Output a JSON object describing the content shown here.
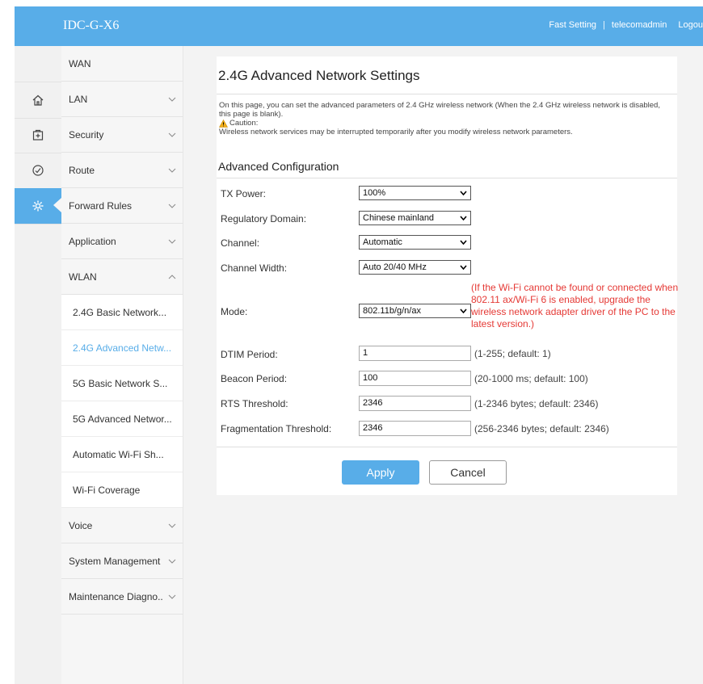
{
  "header": {
    "brand": "IDC-G-X6",
    "fast_setting": "Fast Setting",
    "separator": "|",
    "user": "telecomadmin",
    "logout": "Logou"
  },
  "iconbar": {
    "items": [
      {
        "icon": "home-icon"
      },
      {
        "icon": "plus-box-icon"
      },
      {
        "icon": "check-circle-icon"
      },
      {
        "icon": "gear-icon"
      }
    ]
  },
  "menu": {
    "items": [
      {
        "label": "WAN"
      },
      {
        "label": "LAN"
      },
      {
        "label": "Security"
      },
      {
        "label": "Route"
      },
      {
        "label": "Forward Rules"
      },
      {
        "label": "Application"
      },
      {
        "label": "WLAN"
      }
    ],
    "wlan_sub": [
      {
        "label": "2.4G Basic Network..."
      },
      {
        "label": "2.4G Advanced Netw..."
      },
      {
        "label": "5G Basic Network S..."
      },
      {
        "label": "5G Advanced Networ..."
      },
      {
        "label": "Automatic Wi-Fi Sh..."
      },
      {
        "label": "Wi-Fi Coverage"
      }
    ],
    "more": [
      {
        "label": "Voice"
      },
      {
        "label": "System Management"
      },
      {
        "label": "Maintenance Diagno.."
      }
    ]
  },
  "page": {
    "title": "2.4G Advanced Network Settings",
    "description": "On this page, you can set the advanced parameters of 2.4 GHz wireless network (When the 2.4 GHz wireless network is disabled, this page is blank).",
    "caution_label": "Caution:",
    "caution_text": "Wireless network services may be interrupted temporarily after you modify wireless network parameters.",
    "section": "Advanced Configuration"
  },
  "form": {
    "tx_power": {
      "label": "TX Power:",
      "value": "100%"
    },
    "regulatory": {
      "label": "Regulatory Domain:",
      "value": "Chinese mainland"
    },
    "channel": {
      "label": "Channel:",
      "value": "Automatic"
    },
    "channel_width": {
      "label": "Channel Width:",
      "value": "Auto 20/40 MHz"
    },
    "mode": {
      "label": "Mode:",
      "value": "802.11b/g/n/ax",
      "note": "(If the Wi-Fi cannot be found or connected when 802.11 ax/Wi-Fi 6 is enabled, upgrade the wireless network adapter driver of the PC to the latest version.)"
    },
    "dtim": {
      "label": "DTIM Period:",
      "value": "1",
      "hint": "(1-255; default: 1)"
    },
    "beacon": {
      "label": "Beacon Period:",
      "value": "100",
      "hint": "(20-1000 ms; default: 100)"
    },
    "rts": {
      "label": "RTS Threshold:",
      "value": "2346",
      "hint": "(1-2346 bytes; default: 2346)"
    },
    "frag": {
      "label": "Fragmentation Threshold:",
      "value": "2346",
      "hint": "(256-2346 bytes; default: 2346)"
    }
  },
  "buttons": {
    "apply": "Apply",
    "cancel": "Cancel"
  },
  "colors": {
    "accent": "#58ade8",
    "note": "#e53935"
  }
}
